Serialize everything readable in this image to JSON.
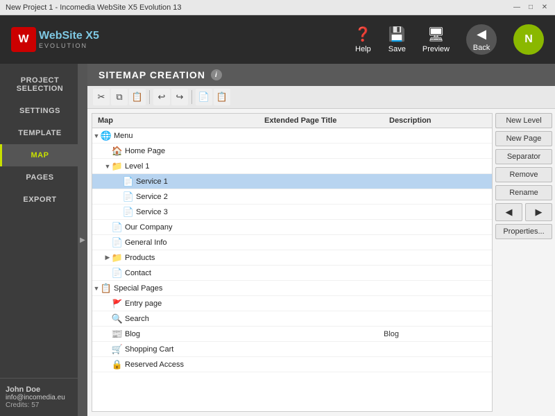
{
  "titlebar": {
    "title": "New Project 1 - Incomedia WebSite X5 Evolution 13",
    "min": "—",
    "max": "□",
    "close": "✕"
  },
  "header": {
    "logo": {
      "icon": "W",
      "brand": "WebSite X5",
      "evolution": "EVOLUTION"
    },
    "tools": [
      {
        "id": "help",
        "label": "Help",
        "icon": "?",
        "dropdown": true
      },
      {
        "id": "save",
        "label": "Save",
        "icon": "💾",
        "dropdown": true
      },
      {
        "id": "preview",
        "label": "Preview",
        "icon": "🖥"
      },
      {
        "id": "back",
        "label": "Back",
        "icon": "◀"
      },
      {
        "id": "next",
        "label": "N",
        "icon": "▶"
      }
    ]
  },
  "sidebar": {
    "items": [
      {
        "id": "project-selection",
        "label": "PROJECT SELECTION",
        "active": false
      },
      {
        "id": "settings",
        "label": "SETTINGS",
        "active": false
      },
      {
        "id": "template",
        "label": "TEMPLATE",
        "active": false
      },
      {
        "id": "map",
        "label": "MAP",
        "active": true
      },
      {
        "id": "pages",
        "label": "PAGES",
        "active": false
      },
      {
        "id": "export",
        "label": "EXPORT",
        "active": false
      }
    ],
    "user": {
      "name": "John Doe",
      "email": "info@incomedia.eu",
      "credits_label": "Credits:",
      "credits_value": "57"
    }
  },
  "page_title": "SITEMAP CREATION",
  "toolbar": {
    "buttons": [
      "✂",
      "📋",
      "📋",
      "↩",
      "↪",
      "📄",
      "📄"
    ]
  },
  "tree": {
    "columns": [
      "Map",
      "Extended Page Title",
      "Description"
    ],
    "rows": [
      {
        "indent": 0,
        "toggle": "▼",
        "icon": "🌐",
        "label": "Menu",
        "extended": "",
        "desc": "",
        "selected": false
      },
      {
        "indent": 1,
        "toggle": "",
        "icon": "🏠",
        "label": "Home Page",
        "extended": "",
        "desc": "",
        "selected": false
      },
      {
        "indent": 1,
        "toggle": "▼",
        "icon": "📁",
        "label": "Level 1",
        "extended": "",
        "desc": "",
        "selected": false,
        "folder": true,
        "open": true
      },
      {
        "indent": 2,
        "toggle": "",
        "icon": "📄",
        "label": "Service 1",
        "extended": "",
        "desc": "",
        "selected": true
      },
      {
        "indent": 2,
        "toggle": "",
        "icon": "📄",
        "label": "Service 2",
        "extended": "",
        "desc": "",
        "selected": false
      },
      {
        "indent": 2,
        "toggle": "",
        "icon": "📄",
        "label": "Service 3",
        "extended": "",
        "desc": "",
        "selected": false
      },
      {
        "indent": 1,
        "toggle": "",
        "icon": "📄",
        "label": "Our Company",
        "extended": "",
        "desc": "",
        "selected": false
      },
      {
        "indent": 1,
        "toggle": "",
        "icon": "📄",
        "label": "General Info",
        "extended": "",
        "desc": "",
        "selected": false
      },
      {
        "indent": 1,
        "toggle": "▶",
        "icon": "📁",
        "label": "Products",
        "extended": "",
        "desc": "",
        "selected": false,
        "folder": true,
        "open": false
      },
      {
        "indent": 1,
        "toggle": "",
        "icon": "📄",
        "label": "Contact",
        "extended": "",
        "desc": "",
        "selected": false
      },
      {
        "indent": 0,
        "toggle": "▼",
        "icon": "📋",
        "label": "Special Pages",
        "extended": "",
        "desc": "",
        "selected": false
      },
      {
        "indent": 1,
        "toggle": "",
        "icon": "🚩",
        "label": "Entry page",
        "extended": "",
        "desc": "",
        "selected": false
      },
      {
        "indent": 1,
        "toggle": "",
        "icon": "🔍",
        "label": "Search",
        "extended": "",
        "desc": "",
        "selected": false
      },
      {
        "indent": 1,
        "toggle": "",
        "icon": "📰",
        "label": "Blog",
        "extended": "",
        "desc": "Blog",
        "selected": false
      },
      {
        "indent": 1,
        "toggle": "",
        "icon": "🛒",
        "label": "Shopping Cart",
        "extended": "",
        "desc": "",
        "selected": false
      },
      {
        "indent": 1,
        "toggle": "",
        "icon": "🔒",
        "label": "Reserved Access",
        "extended": "",
        "desc": "",
        "selected": false
      }
    ]
  },
  "right_panel": {
    "buttons": [
      {
        "id": "new-level",
        "label": "New Level"
      },
      {
        "id": "new-page",
        "label": "New Page"
      },
      {
        "id": "separator",
        "label": "Separator"
      },
      {
        "id": "remove",
        "label": "Remove"
      },
      {
        "id": "rename",
        "label": "Rename"
      },
      {
        "id": "arrow-left",
        "label": "◀"
      },
      {
        "id": "arrow-right",
        "label": "▶"
      },
      {
        "id": "properties",
        "label": "Properties..."
      }
    ]
  }
}
